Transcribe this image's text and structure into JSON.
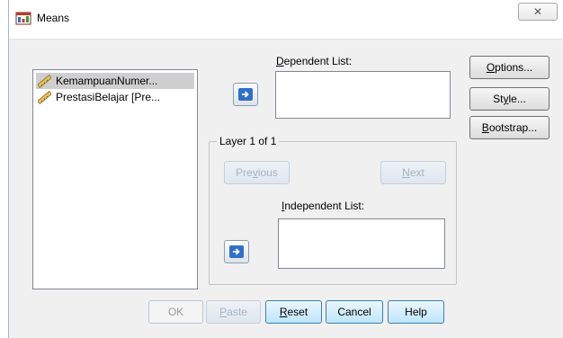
{
  "window": {
    "title": "Means",
    "close_glyph": "✕"
  },
  "variables": [
    {
      "label": "KemampuanNumer...",
      "icon": "scale-ruler-icon",
      "selected": true
    },
    {
      "label": "PrestasiBelajar [Pre...",
      "icon": "scale-ruler-icon",
      "selected": false
    }
  ],
  "dependent": {
    "label_prefix": "",
    "label_u": "D",
    "label_rest": "ependent List:"
  },
  "layer": {
    "legend": "Layer 1 of 1",
    "previous": {
      "pre": "Pre",
      "u": "v",
      "post": "ious"
    },
    "next": {
      "pre": "",
      "u": "N",
      "post": "ext"
    }
  },
  "independent": {
    "label_u": "I",
    "label_rest": "ndependent List:"
  },
  "side_buttons": {
    "options": {
      "u": "O",
      "rest": "ptions..."
    },
    "style": {
      "pre": "St",
      "u": "y",
      "post": "le..."
    },
    "bootstrap": {
      "u": "B",
      "rest": "ootstrap..."
    }
  },
  "bottom_buttons": {
    "ok": "OK",
    "paste": {
      "u": "P",
      "rest": "aste"
    },
    "reset": {
      "u": "R",
      "rest": "eset"
    },
    "cancel": "Cancel",
    "help": "Help"
  },
  "colors": {
    "accent": "#2f6fc9",
    "dialog_bg": "#f0f0f0"
  }
}
